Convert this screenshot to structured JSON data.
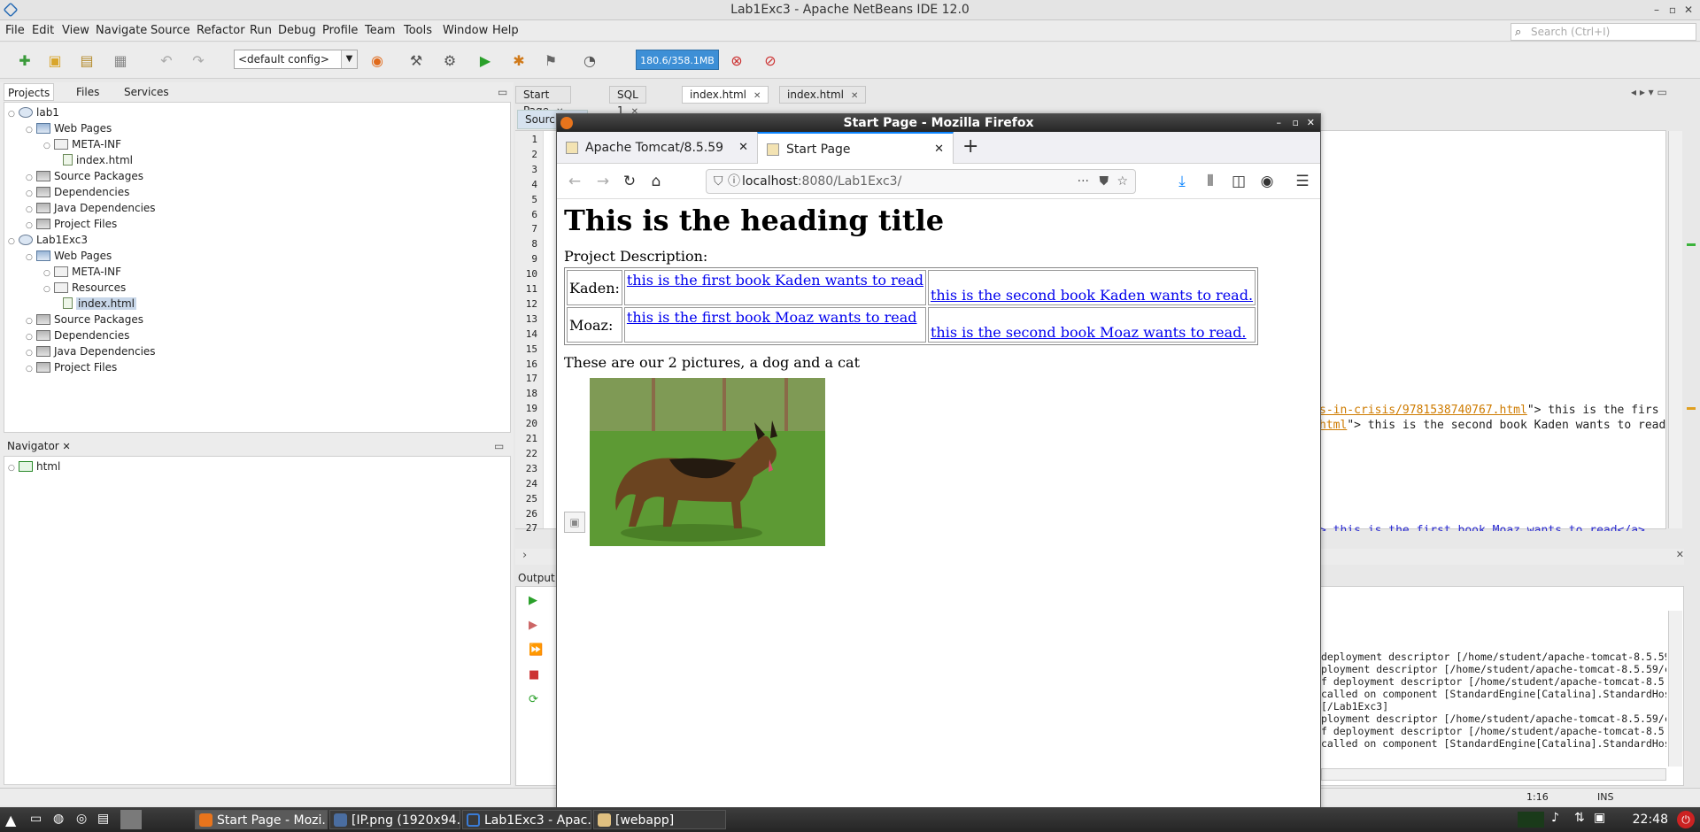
{
  "window_title": "Lab1Exc3 - Apache NetBeans IDE 12.0",
  "menu": [
    "File",
    "Edit",
    "View",
    "Navigate",
    "Source",
    "Refactor",
    "Run",
    "Debug",
    "Profile",
    "Team",
    "Tools",
    "Window",
    "Help"
  ],
  "search_placeholder": "Search (Ctrl+I)",
  "toolbar": {
    "config": "<default config>",
    "memory": "180.6/358.1MB"
  },
  "panel_tabs": [
    "Projects",
    "Files",
    "Services"
  ],
  "projects": [
    {
      "label": "lab1",
      "icon": "project-icon"
    },
    {
      "label": "Web Pages",
      "icon": "web-pages-icon"
    },
    {
      "label": "META-INF",
      "icon": "folder-icon"
    },
    {
      "label": "index.html",
      "icon": "html-file-icon"
    },
    {
      "label": "Source Packages",
      "icon": "package-icon"
    },
    {
      "label": "Dependencies",
      "icon": "package-icon"
    },
    {
      "label": "Java Dependencies",
      "icon": "package-icon"
    },
    {
      "label": "Project Files",
      "icon": "package-icon"
    },
    {
      "label": "Lab1Exc3",
      "icon": "project-icon"
    },
    {
      "label": "Web Pages",
      "icon": "web-pages-icon"
    },
    {
      "label": "META-INF",
      "icon": "folder-icon"
    },
    {
      "label": "Resources",
      "icon": "folder-icon"
    },
    {
      "label": "index.html",
      "icon": "html-file-icon"
    },
    {
      "label": "Source Packages",
      "icon": "package-icon"
    },
    {
      "label": "Dependencies",
      "icon": "package-icon"
    },
    {
      "label": "Java Dependencies",
      "icon": "package-icon"
    },
    {
      "label": "Project Files",
      "icon": "package-icon"
    }
  ],
  "navigator": {
    "title": "Navigator",
    "root": "html"
  },
  "editor_tabs": [
    "Start Page",
    "SQL 1",
    "index.html",
    "index.html"
  ],
  "editor_subtab": "Sourc",
  "line_numbers": [
    "1",
    "2",
    "3",
    "4",
    "5",
    "6",
    "7",
    "8",
    "9",
    "10",
    "11",
    "12",
    "13",
    "14",
    "15",
    "16",
    "17",
    "18",
    "19",
    "20",
    "21",
    "22",
    "23",
    "24",
    "25",
    "26",
    "27"
  ],
  "code_lines": [
    {
      "a": "s-in-crisis/9781538740767.html",
      "b": "\"> this is the firs"
    },
    {
      "a": "html",
      "b": "\"> this is the second book Kaden wants to read"
    },
    {
      "a": "",
      "b": "> this is the first book Moaz wants to read</a>"
    }
  ],
  "output_title": "Output",
  "log_lines": [
    " deployment descriptor [/home/student/apache-tomcat-8.5.59",
    "ployment descriptor [/home/student/apache-tomcat-8.5.59/co",
    "f deployment descriptor [/home/student/apache-tomcat-8.5.5",
    "called on component [StandardEngine[Catalina].StandardHost",
    "[/Lab1Exc3]",
    "ployment descriptor [/home/student/apache-tomcat-8.5.59/co",
    "f deployment descriptor [/home/student/apache-tomcat-8.5.5",
    "called on component [StandardEngine[Catalina].StandardHost"
  ],
  "status": {
    "position": "1:16",
    "mode": "INS"
  },
  "firefox": {
    "title": "Start Page - Mozilla Firefox",
    "tabs": [
      "Apache Tomcat/8.5.59",
      "Start Page"
    ],
    "url_host": "localhost",
    "url_rest": ":8080/Lab1Exc3/",
    "page": {
      "heading": "This is the heading title",
      "description": "Project Description:",
      "rows": [
        {
          "name": "Kaden:",
          "link1": "this is the first book Kaden wants to read",
          "link2": "this is the second book Kaden wants to read."
        },
        {
          "name": "Moaz:",
          "link1": "this is the first book Moaz wants to read",
          "link2": "this is the second book Moaz wants to read."
        }
      ],
      "pictures_caption": "These are our 2 pictures, a dog and a cat"
    }
  },
  "taskbar": {
    "items": [
      "Start Page - Mozi...",
      "[IP.png (1920x94...",
      "Lab1Exc3 - Apac...",
      "[webapp]"
    ],
    "clock": "22:48"
  }
}
